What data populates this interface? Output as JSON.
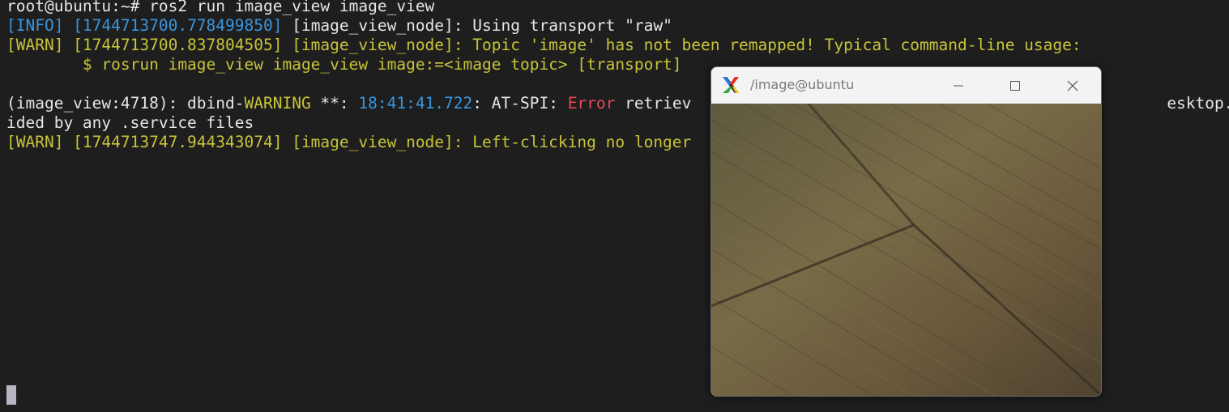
{
  "terminal": {
    "lines": [
      [
        {
          "t": "root@ubuntu:~# ros2 run image_view image_view",
          "c": "c-white"
        }
      ],
      [
        {
          "t": "[INFO] ",
          "c": "c-cyan"
        },
        {
          "t": "[1744713700.778499850]",
          "c": "c-cyan"
        },
        {
          "t": " [image_view_node]: Using transport \"raw\"",
          "c": "c-white"
        }
      ],
      [
        {
          "t": "[WARN] [1744713700.837804505] [image_view_node]: Topic 'image' has not been remapped! Typical command-line usage:",
          "c": "c-yellow"
        }
      ],
      [
        {
          "t": "        $ rosrun image_view image_view image:=<image topic> [transport]",
          "c": "c-yellow"
        }
      ],
      [
        {
          "t": "",
          "c": "c-white"
        }
      ],
      [
        {
          "t": "(image_view:4718): dbind-",
          "c": "c-white"
        },
        {
          "t": "WARNING",
          "c": "c-yellow"
        },
        {
          "t": " **: ",
          "c": "c-white"
        },
        {
          "t": "18:41:41.722",
          "c": "c-timecyan"
        },
        {
          "t": ": AT-SPI: ",
          "c": "c-white"
        },
        {
          "t": "Error",
          "c": "c-red"
        },
        {
          "t": " retriev",
          "c": "c-white"
        },
        {
          "t": "                                                  ",
          "c": "c-white"
        },
        {
          "t": "esktop.DBus.E",
          "c": "c-white"
        }
      ],
      [
        {
          "t": "ided by any .service files",
          "c": "c-white"
        }
      ],
      [
        {
          "t": "[WARN] [1744713747.944343074] [image_view_node]: Left-clicking no longer",
          "c": "c-yellow"
        }
      ]
    ]
  },
  "window": {
    "title": "/image@ubuntu",
    "icons": {
      "app": "x-logo-icon",
      "minimize": "minimize-icon",
      "maximize": "maximize-icon",
      "close": "close-icon"
    }
  }
}
